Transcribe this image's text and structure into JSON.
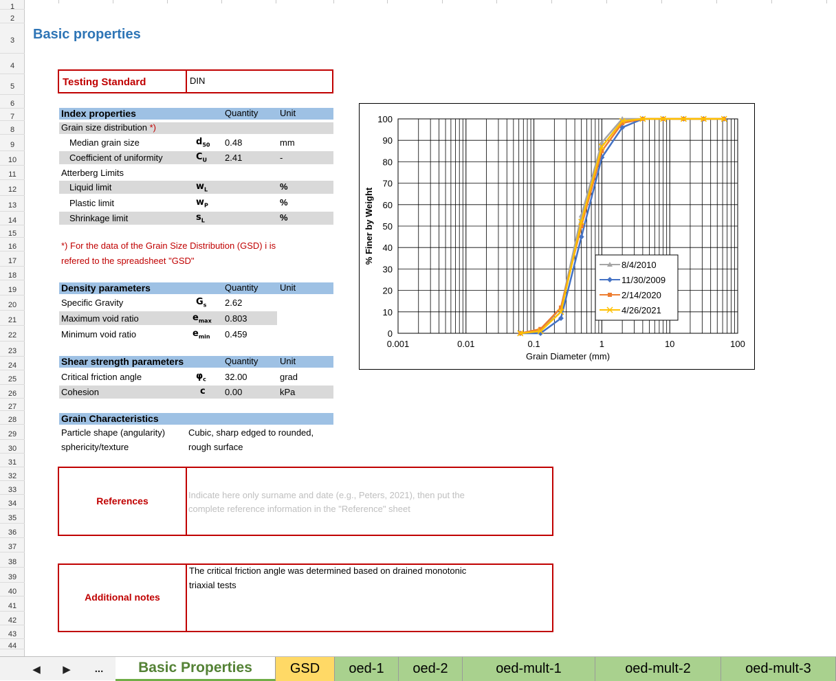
{
  "title": "Basic properties",
  "testing_standard": {
    "label": "Testing Standard",
    "value": "DIN"
  },
  "index_properties": {
    "header": "Index properties",
    "quantity_header": "Quantity",
    "unit_header": "Unit",
    "grain_size_label": "Grain size distribution",
    "grain_size_star": "*)",
    "d50": {
      "label": "Median grain size",
      "symbol": "d",
      "sub": "50",
      "value": "0.48",
      "unit": "mm"
    },
    "cu": {
      "label": "Coefficient of uniformity",
      "symbol": "C",
      "sub": "U",
      "value": "2.41",
      "unit": "-"
    },
    "atterberg_label": "Atterberg Limits",
    "wl": {
      "label": "Liquid limit",
      "symbol": "w",
      "sub": "L",
      "value": "",
      "unit": "%"
    },
    "wp": {
      "label": "Plastic limit",
      "symbol": "w",
      "sub": "P",
      "value": "",
      "unit": "%"
    },
    "sl": {
      "label": "Shrinkage limit",
      "symbol": "s",
      "sub": "L",
      "value": "",
      "unit": "%"
    }
  },
  "footnote": {
    "line1": "*) For the data of the Grain Size Distribution (GSD) i is",
    "line2": "refered to the spreadsheet \"GSD\""
  },
  "density": {
    "header": "Density parameters",
    "quantity_header": "Quantity",
    "unit_header": "Unit",
    "gs": {
      "label": "Specific Gravity",
      "symbol": "G",
      "sub": "s",
      "value": "2.62"
    },
    "emax": {
      "label": "Maximum void ratio",
      "symbol": "e",
      "sub": "max",
      "value": "0.803"
    },
    "emin": {
      "label": "Minimum void ratio",
      "symbol": "e",
      "sub": "min",
      "value": "0.459"
    }
  },
  "shear": {
    "header": "Shear strength parameters",
    "quantity_header": "Quantity",
    "unit_header": "Unit",
    "phi": {
      "label": "Critical friction angle",
      "symbol": "φ",
      "sub": "c",
      "value": "32.00",
      "unit": "grad"
    },
    "c": {
      "label": "Cohesion",
      "symbol": "c",
      "value": "0.00",
      "unit": "kPa"
    }
  },
  "grain": {
    "header": "Grain Characteristics",
    "label1": "Particle shape (angularity)",
    "label2": "sphericity/texture",
    "value1": "Cubic, sharp edged to rounded,",
    "value2": "rough surface"
  },
  "references": {
    "label": "References",
    "hint1": "Indicate here only surname and date (e.g., Peters, 2021), then put the",
    "hint2": "complete reference information in the \"Reference\" sheet"
  },
  "notes": {
    "label": "Additional notes",
    "text1": "The critical friction angle was determined based on drained monotonic",
    "text2": "triaxial tests"
  },
  "tabs": [
    {
      "label": "Basic Properties",
      "active": true
    },
    {
      "label": "GSD"
    },
    {
      "label": "oed-1"
    },
    {
      "label": "oed-2"
    },
    {
      "label": "oed-mult-1"
    },
    {
      "label": "oed-mult-2"
    },
    {
      "label": "oed-mult-3"
    }
  ],
  "nav": {
    "prev": "◀",
    "next": "▶",
    "more": "..."
  },
  "colors": {
    "accent_blue": "#2e75b6",
    "red": "#c00000",
    "tab_green": "#a9d18e",
    "tab_yellow": "#ffd966"
  },
  "chart_data": {
    "type": "line",
    "xscale": "log",
    "xlim": [
      0.001,
      100
    ],
    "ylim": [
      0,
      100
    ],
    "xticks": [
      "0.001",
      "0.01",
      "0.1",
      "1",
      "10",
      "100"
    ],
    "yticks": [
      "0",
      "10",
      "20",
      "30",
      "40",
      "50",
      "60",
      "70",
      "80",
      "90",
      "100"
    ],
    "xlabel": "Grain Diameter (mm)",
    "ylabel": "% Finer by Weight",
    "legend_position": "right",
    "series": [
      {
        "name": "8/4/2010",
        "color": "#a5a5a5",
        "marker": "triangle",
        "x": [
          0.063,
          0.125,
          0.25,
          0.5,
          1,
          2,
          4,
          8,
          16,
          31.5,
          63
        ],
        "y": [
          0,
          1,
          12,
          55,
          89,
          100,
          100,
          100,
          100,
          100,
          100
        ]
      },
      {
        "name": "11/30/2009",
        "color": "#4472c4",
        "marker": "diamond",
        "x": [
          0.063,
          0.125,
          0.25,
          0.5,
          1,
          2,
          4,
          8,
          16,
          31.5,
          63
        ],
        "y": [
          0,
          0,
          7,
          45,
          82,
          96,
          100,
          100,
          100,
          100,
          100
        ]
      },
      {
        "name": "2/14/2020",
        "color": "#ed7d31",
        "marker": "square",
        "x": [
          0.063,
          0.125,
          0.25,
          0.5,
          1,
          2,
          4,
          8,
          16,
          31.5,
          63
        ],
        "y": [
          0,
          2,
          12,
          50,
          85,
          98,
          100,
          100,
          100,
          100,
          100
        ]
      },
      {
        "name": "4/26/2021",
        "color": "#ffc000",
        "marker": "x",
        "x": [
          0.063,
          0.125,
          0.25,
          0.5,
          1,
          2,
          4,
          8,
          16,
          31.5,
          63
        ],
        "y": [
          0,
          1,
          10,
          52,
          87,
          99,
          100,
          100,
          100,
          100,
          100
        ]
      }
    ]
  }
}
